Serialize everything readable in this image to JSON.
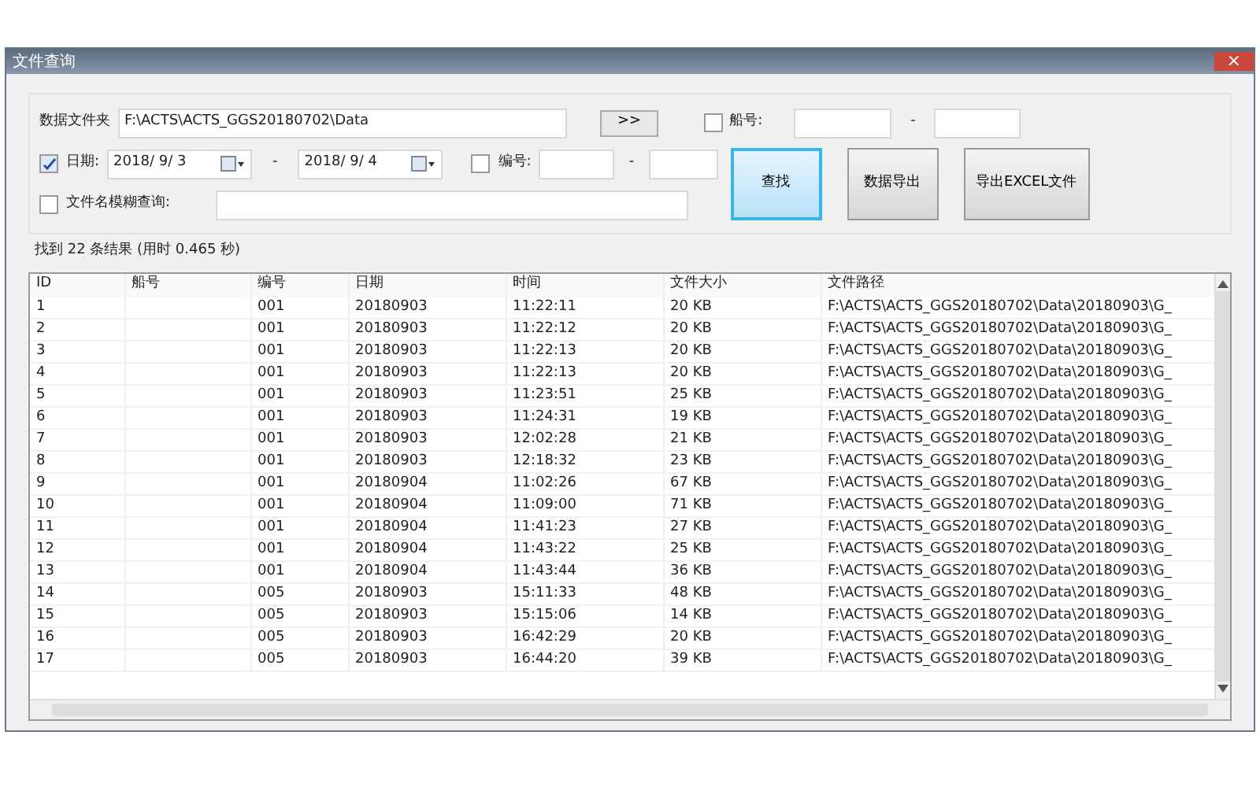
{
  "window": {
    "title": "文件查询",
    "close": "×"
  },
  "folder": {
    "label": "数据文件夹",
    "value": "F:\\ACTS\\ACTS_GGS20180702\\Data",
    "browse": ">>"
  },
  "ship_filter": {
    "label": "船号:",
    "checked": false,
    "separator": "-"
  },
  "date_filter": {
    "label": "日期:",
    "checked": true,
    "from": "2018/ 9/ 3",
    "to": "2018/ 9/ 4",
    "separator": "-"
  },
  "number_filter": {
    "label": "编号:",
    "checked": false,
    "separator": "-"
  },
  "name_filter": {
    "label": "文件名模糊查询:",
    "checked": false
  },
  "buttons": [
    {
      "label": "查找",
      "default": true
    },
    {
      "label": "数据导出",
      "default": false
    },
    {
      "label": "导出EXCEL文件",
      "default": false
    }
  ],
  "result": "找到 22 条结果 (用时 0.465 秒)",
  "table": {
    "columns": [
      "ID",
      "船号",
      "编号",
      "日期",
      "时间",
      "文件大小",
      "文件路径"
    ],
    "rows": [
      [
        "1",
        "",
        "001",
        "20180903",
        "11:22:11",
        "20 KB",
        "F:\\ACTS\\ACTS_GGS20180702\\Data\\20180903\\G_"
      ],
      [
        "2",
        "",
        "001",
        "20180903",
        "11:22:12",
        "20 KB",
        "F:\\ACTS\\ACTS_GGS20180702\\Data\\20180903\\G_"
      ],
      [
        "3",
        "",
        "001",
        "20180903",
        "11:22:13",
        "20 KB",
        "F:\\ACTS\\ACTS_GGS20180702\\Data\\20180903\\G_"
      ],
      [
        "4",
        "",
        "001",
        "20180903",
        "11:22:13",
        "20 KB",
        "F:\\ACTS\\ACTS_GGS20180702\\Data\\20180903\\G_"
      ],
      [
        "5",
        "",
        "001",
        "20180903",
        "11:23:51",
        "25 KB",
        "F:\\ACTS\\ACTS_GGS20180702\\Data\\20180903\\G_"
      ],
      [
        "6",
        "",
        "001",
        "20180903",
        "11:24:31",
        "19 KB",
        "F:\\ACTS\\ACTS_GGS20180702\\Data\\20180903\\G_"
      ],
      [
        "7",
        "",
        "001",
        "20180903",
        "12:02:28",
        "21 KB",
        "F:\\ACTS\\ACTS_GGS20180702\\Data\\20180903\\G_"
      ],
      [
        "8",
        "",
        "001",
        "20180903",
        "12:18:32",
        "23 KB",
        "F:\\ACTS\\ACTS_GGS20180702\\Data\\20180903\\G_"
      ],
      [
        "9",
        "",
        "001",
        "20180904",
        "11:02:26",
        "67 KB",
        "F:\\ACTS\\ACTS_GGS20180702\\Data\\20180903\\G_"
      ],
      [
        "10",
        "",
        "001",
        "20180904",
        "11:09:00",
        "71 KB",
        "F:\\ACTS\\ACTS_GGS20180702\\Data\\20180903\\G_"
      ],
      [
        "11",
        "",
        "001",
        "20180904",
        "11:41:23",
        "27 KB",
        "F:\\ACTS\\ACTS_GGS20180702\\Data\\20180903\\G_"
      ],
      [
        "12",
        "",
        "001",
        "20180904",
        "11:43:22",
        "25 KB",
        "F:\\ACTS\\ACTS_GGS20180702\\Data\\20180903\\G_"
      ],
      [
        "13",
        "",
        "001",
        "20180904",
        "11:43:44",
        "36 KB",
        "F:\\ACTS\\ACTS_GGS20180702\\Data\\20180903\\G_"
      ],
      [
        "14",
        "",
        "005",
        "20180903",
        "15:11:33",
        "48 KB",
        "F:\\ACTS\\ACTS_GGS20180702\\Data\\20180903\\G_"
      ],
      [
        "15",
        "",
        "005",
        "20180903",
        "15:15:06",
        "14 KB",
        "F:\\ACTS\\ACTS_GGS20180702\\Data\\20180903\\G_"
      ],
      [
        "16",
        "",
        "005",
        "20180903",
        "16:42:29",
        "20 KB",
        "F:\\ACTS\\ACTS_GGS20180702\\Data\\20180903\\G_"
      ],
      [
        "17",
        "",
        "005",
        "20180903",
        "16:44:20",
        "39 KB",
        "F:\\ACTS\\ACTS_GGS20180702\\Data\\20180903\\G_"
      ]
    ]
  }
}
